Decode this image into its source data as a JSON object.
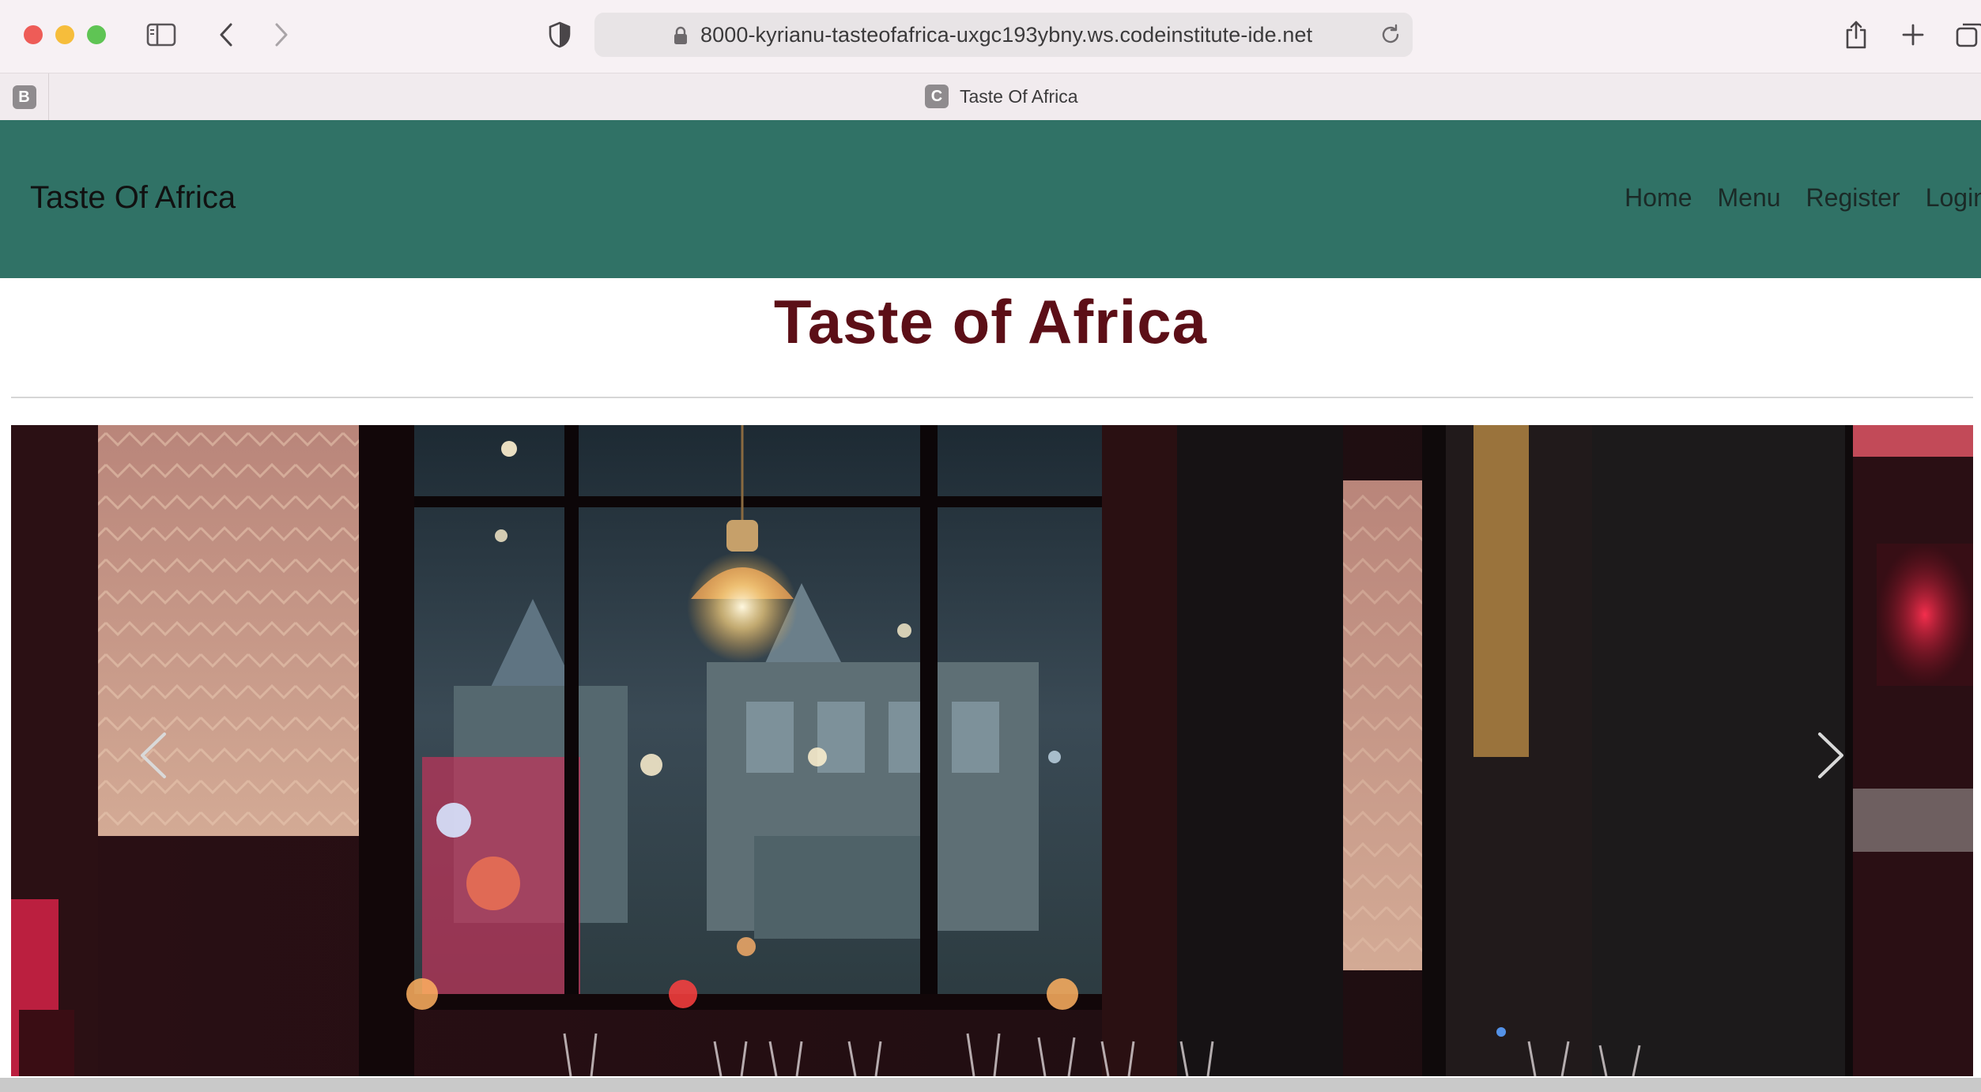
{
  "browser": {
    "url": "8000-kyrianu-tasteofafrica-uxgc193ybny.ws.codeinstitute-ide.net",
    "pinned_tab_letter": "B",
    "active_tab": {
      "favicon_letter": "C",
      "title": "Taste Of Africa"
    }
  },
  "navbar": {
    "brand": "Taste Of Africa",
    "links": [
      "Home",
      "Menu",
      "Register",
      "Login"
    ],
    "color": "#307266"
  },
  "main": {
    "title": "Taste of Africa",
    "title_color": "#5c0f17"
  },
  "carousel": {
    "image": "restaurant-interior-night",
    "prev_icon": "chevron-left-icon",
    "next_icon": "chevron-right-icon"
  }
}
